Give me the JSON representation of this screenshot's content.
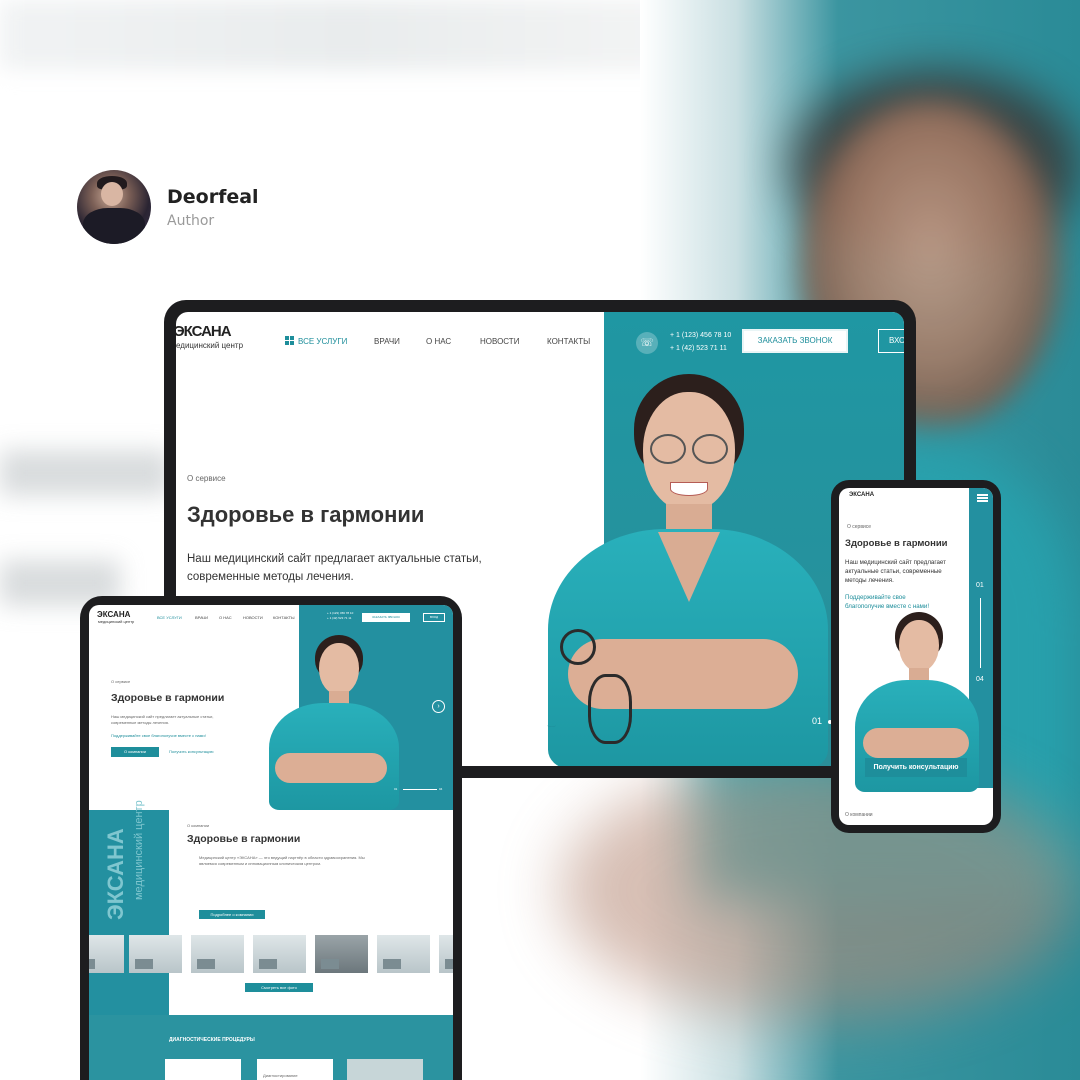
{
  "author": {
    "name": "Deorfeal",
    "role": "Author"
  },
  "site": {
    "logo_main": "ЭКСАНА",
    "logo_sub": "медицинский центр",
    "logo_main_crop": "ЭКСАНА",
    "logo_sub_crop": "едицинский центр",
    "nav": [
      "ВСЕ УСЛУГИ",
      "ВРАЧИ",
      "О НАС",
      "НОВОСТИ",
      "КОНТАКТЫ"
    ],
    "phones": [
      "+ 1 (123) 456 78 10",
      "+ 1 (42) 523 71 11"
    ],
    "call_button": "ЗАКАЗАТЬ ЗВОНОК",
    "login_button": "ВХОД",
    "login_button_crop": "ВХО",
    "kicker": "О сервисе",
    "hero_title": "Здоровье в гармонии",
    "hero_lead_1": "Наш медицинский сайт предлагает актуальные статьи,",
    "hero_lead_2": "современные методы лечения.",
    "hero_lead_mobile": "Наш медицинский сайт предлагает актуальные статьи, современные методы лечения.",
    "cta_link": "Поддерживайте свое благополучие вместе с нами!",
    "cta_link_mobile": "Поддерживайте свое благополучие вместе с нами!",
    "btn_about": "О компании",
    "btn_consult": "Получить консультацию",
    "slide_current": "01",
    "slide_total": "04",
    "about_kicker": "О компании",
    "about_title": "Здоровье в гармонии",
    "about_text": "Медицинский центр «ЭКСАНА» — это ведущий партнёр в области здравоохранения. Мы являемся современным и инновационным клиническим центром.",
    "about_button": "Подробнее о компании",
    "gallery_button": "Смотреть все фото",
    "diag_title": "ДИАГНОСТИЧЕСКИЕ ПРОЦЕДУРЫ",
    "diag_card": "Диагностирование",
    "mobile_footer_kicker": "О компании"
  },
  "colors": {
    "teal": "#2390a0",
    "teal_dark": "#1e8e9b",
    "frame": "#1d1d1f"
  }
}
